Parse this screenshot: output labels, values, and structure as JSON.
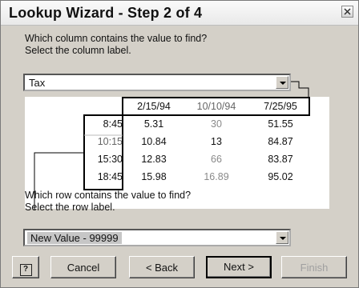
{
  "window": {
    "title": "Lookup Wizard - Step 2 of 4"
  },
  "step": {
    "column_question_line1": "Which column contains the value to find?",
    "column_question_line2": "Select the column label.",
    "column_selected": "Tax",
    "row_question_line1": "Which row contains the value to find?",
    "row_question_line2": "Select the row label.",
    "row_selected": "New Value - 99999"
  },
  "preview": {
    "columns": [
      "2/15/94",
      "10/10/94",
      "7/25/95"
    ],
    "rows": [
      {
        "label": "8:45",
        "values": [
          "5.31",
          "30",
          "51.55"
        ]
      },
      {
        "label": "10:15",
        "values": [
          "10.84",
          "13",
          "84.87"
        ]
      },
      {
        "label": "15:30",
        "values": [
          "12.83",
          "66",
          "83.87"
        ]
      },
      {
        "label": "18:45",
        "values": [
          "15.98",
          "16.89",
          "95.02"
        ]
      }
    ]
  },
  "buttons": {
    "help": "?",
    "cancel": "Cancel",
    "back": "< Back",
    "next": "Next >",
    "finish": "Finish"
  }
}
